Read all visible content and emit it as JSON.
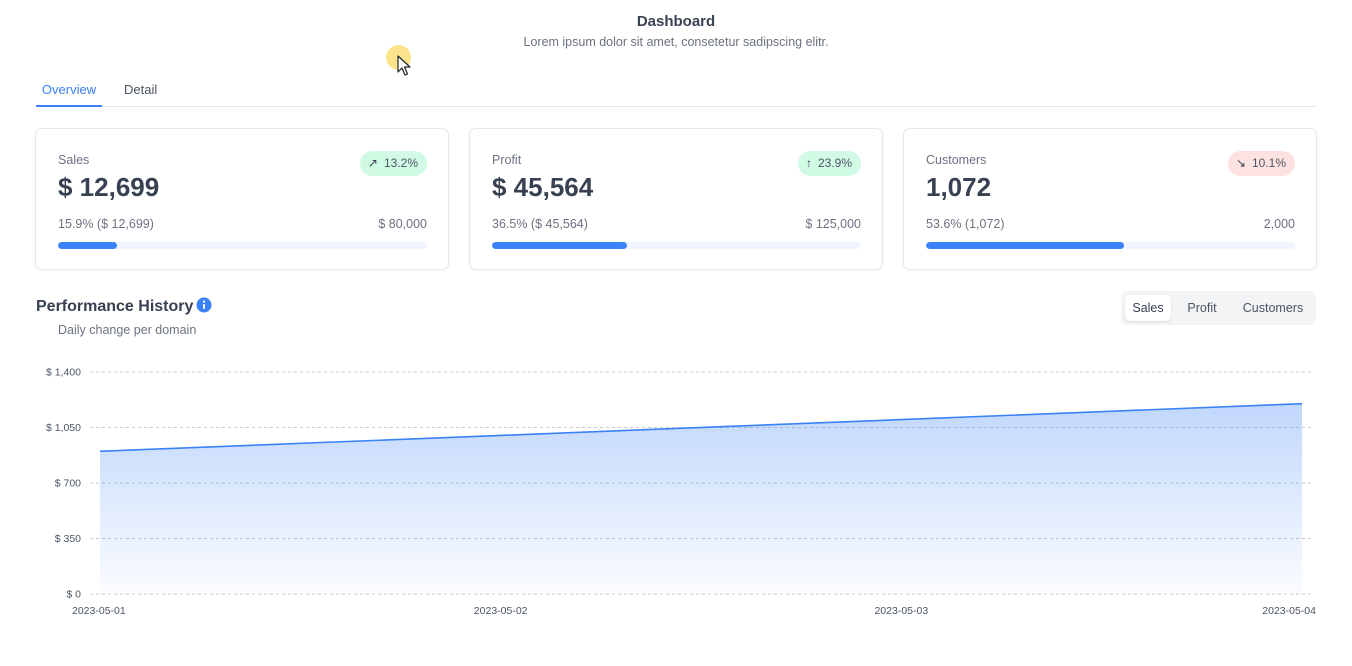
{
  "header": {
    "title": "Dashboard",
    "subtitle": "Lorem ipsum dolor sit amet, consetetur sadipscing elitr."
  },
  "tabs": [
    {
      "label": "Overview",
      "active": true
    },
    {
      "label": "Detail",
      "active": false
    }
  ],
  "cards": [
    {
      "label": "Sales",
      "value": "$ 12,699",
      "delta": "13.2%",
      "delta_dir": "up-right",
      "delta_arrow": "↗",
      "progress_text": "15.9% ($ 12,699)",
      "target": "$ 80,000",
      "progress": 0.159
    },
    {
      "label": "Profit",
      "value": "$ 45,564",
      "delta": "23.9%",
      "delta_dir": "up",
      "delta_arrow": "↑",
      "progress_text": "36.5% ($ 45,564)",
      "target": "$ 125,000",
      "progress": 0.365
    },
    {
      "label": "Customers",
      "value": "1,072",
      "delta": "10.1%",
      "delta_dir": "down-right",
      "delta_arrow": "↘",
      "progress_text": "53.6% (1,072)",
      "target": "2,000",
      "progress": 0.536
    }
  ],
  "performance": {
    "title": "Performance History",
    "subtitle": "Daily change per domain",
    "info_icon": "info-icon",
    "toggle_options": [
      "Sales",
      "Profit",
      "Customers"
    ],
    "toggle_selected": "Sales"
  },
  "colors": {
    "accent": "#3b82f6",
    "up_badge_bg": "#d1fae5",
    "down_badge_bg": "#fee2e2"
  },
  "chart_data": {
    "type": "area",
    "title": "",
    "xlabel": "",
    "ylabel": "",
    "x": [
      "2023-05-01",
      "2023-05-02",
      "2023-05-03",
      "2023-05-04"
    ],
    "series": [
      {
        "values": [
          900,
          1000,
          1100,
          1200
        ]
      }
    ],
    "ylim": [
      0,
      1400
    ],
    "yticks": [
      0,
      350,
      700,
      1050,
      1400
    ],
    "ytick_labels": [
      "$ 0",
      "$ 350",
      "$ 700",
      "$ 1,050",
      "$ 1,400"
    ],
    "grid": true,
    "legend": "none"
  }
}
